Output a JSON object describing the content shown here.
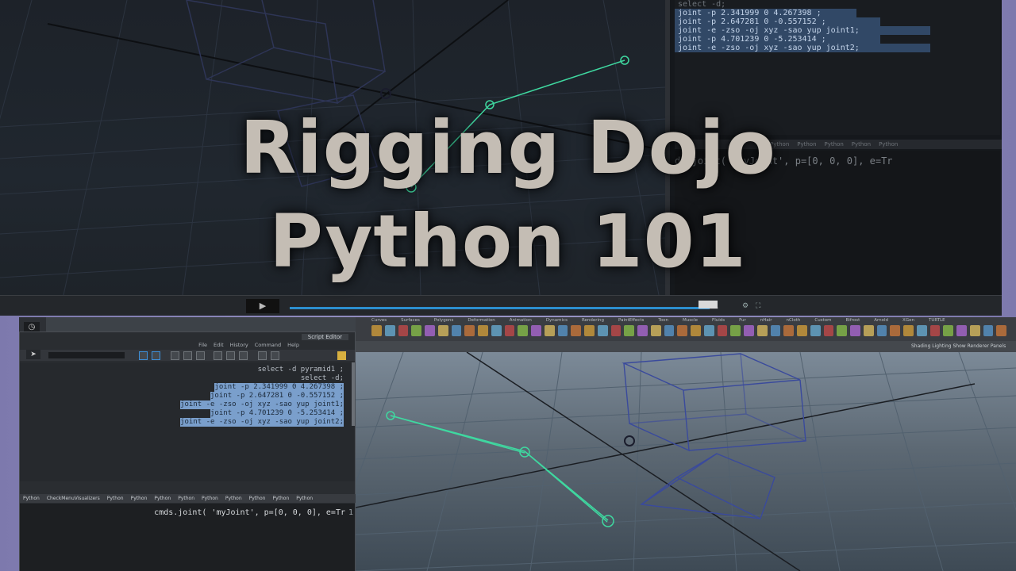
{
  "title": {
    "line1": "Rigging Dojo",
    "line2": "Python 101"
  },
  "upper_editor": {
    "history": [
      {
        "text": "select -d;",
        "selected": false
      },
      {
        "text": "joint -p 2.341999 0 4.267398 ;",
        "selected": true
      },
      {
        "text": "joint -p 2.647281 0 -0.557152 ;",
        "selected": true
      },
      {
        "text": "joint -e -zso -oj xyz -sao yup joint1;",
        "selected": true
      },
      {
        "text": "joint -p 4.701239 0 -5.253414 ;",
        "selected": true
      },
      {
        "text": "joint -e -zso -oj xyz -sao yup joint2;",
        "selected": true
      }
    ],
    "tabs": [
      "Python",
      "Python",
      "Python",
      "Python",
      "Python"
    ],
    "input_line": "ds.joint( 'myJoint', p=[0, 0, 0], e=Tr"
  },
  "timebar": {
    "play_label": "▶",
    "progress": 0.98
  },
  "script_editor": {
    "title": "Script Editor",
    "menu": [
      "File",
      "Edit",
      "History",
      "Command",
      "Help"
    ],
    "history": [
      {
        "text": "select -d pyramid1 ;",
        "selected": false
      },
      {
        "text": "select -d;",
        "selected": false
      },
      {
        "text": "joint -p 2.341999 0 4.267398 ;",
        "selected": true
      },
      {
        "text": "joint -p 2.647281 0 -0.557152 ;",
        "selected": true
      },
      {
        "text": "joint -e -zso -oj xyz -sao yup joint1;",
        "selected": true
      },
      {
        "text": "joint -p 4.701239 0 -5.253414 ;",
        "selected": true
      },
      {
        "text": "joint -e -zso -oj xyz -sao yup joint2;",
        "selected": true
      }
    ],
    "tabs": [
      "Python",
      "CheckMenuVisualizers",
      "Python",
      "Python",
      "Python",
      "Python",
      "Python",
      "Python",
      "Python",
      "Python",
      "Python"
    ],
    "code": "cmds.joint( 'myJoint', p=[0, 0, 0], e=Tr",
    "line_number": "1"
  },
  "shelf": {
    "tabs": [
      "Curves",
      "Surfaces",
      "Polygons",
      "Deformation",
      "Animation",
      "Dynamics",
      "Rendering",
      "PaintEffects",
      "Toon",
      "Muscle",
      "Fluids",
      "Fur",
      "nHair",
      "nCloth",
      "Custom",
      "Bifrost",
      "Arnold",
      "XGen",
      "TURTLE"
    ],
    "panel_menu": [
      "Shading",
      "Lighting",
      "Show",
      "Renderer",
      "Panels"
    ]
  },
  "colors": {
    "joint": "#3fd8a0",
    "wire": "#3a4a9c",
    "selection": "#7a9fcc",
    "progress": "#2c8fd0"
  }
}
